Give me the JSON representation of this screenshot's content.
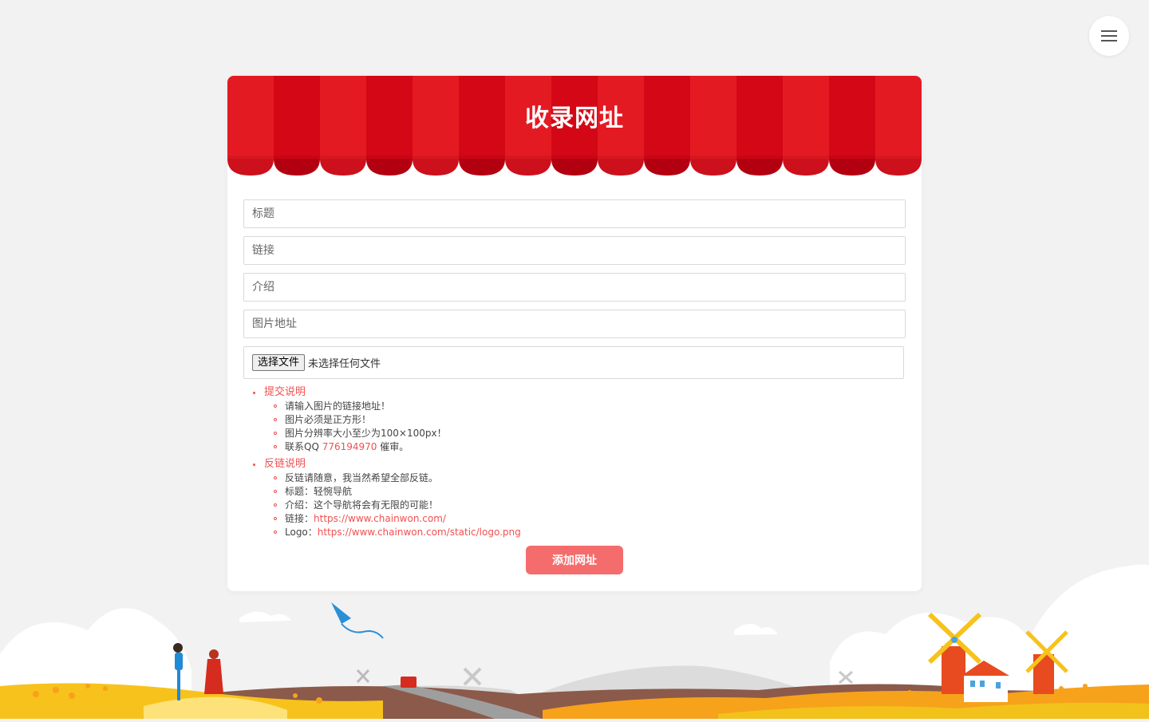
{
  "header": {
    "title": "收录网址"
  },
  "menu": {
    "icon": "hamburger-menu-icon"
  },
  "form": {
    "title_placeholder": "标题",
    "link_placeholder": "链接",
    "intro_placeholder": "介绍",
    "image_placeholder": "图片地址",
    "file_button": "选择文件",
    "file_status": "未选择任何文件",
    "submit": "添加网址"
  },
  "notes": {
    "submit_title": "提交说明",
    "submit_items": [
      "请输入图片的链接地址！",
      "图片必须是正方形！",
      "图片分辨率大小至少为100×100px！"
    ],
    "contact_prefix": "联系QQ ",
    "contact_qq": "776194970",
    "contact_suffix": " 催审。",
    "backlink_title": "反链说明",
    "backlink_items": [
      "反链请随意，我当然希望全部反链。",
      "标题：轻惋导航",
      "介绍：这个导航将会有无限的可能！"
    ],
    "link_label": "链接：",
    "link_url": "https://www.chainwon.com/",
    "logo_label": "Logo：",
    "logo_url": "https://www.chainwon.com/static/logo.png"
  },
  "colors": {
    "accent": "#f05050",
    "awning_light": "#e41a23",
    "awning_dark": "#d40716",
    "button": "#f56c6c"
  }
}
